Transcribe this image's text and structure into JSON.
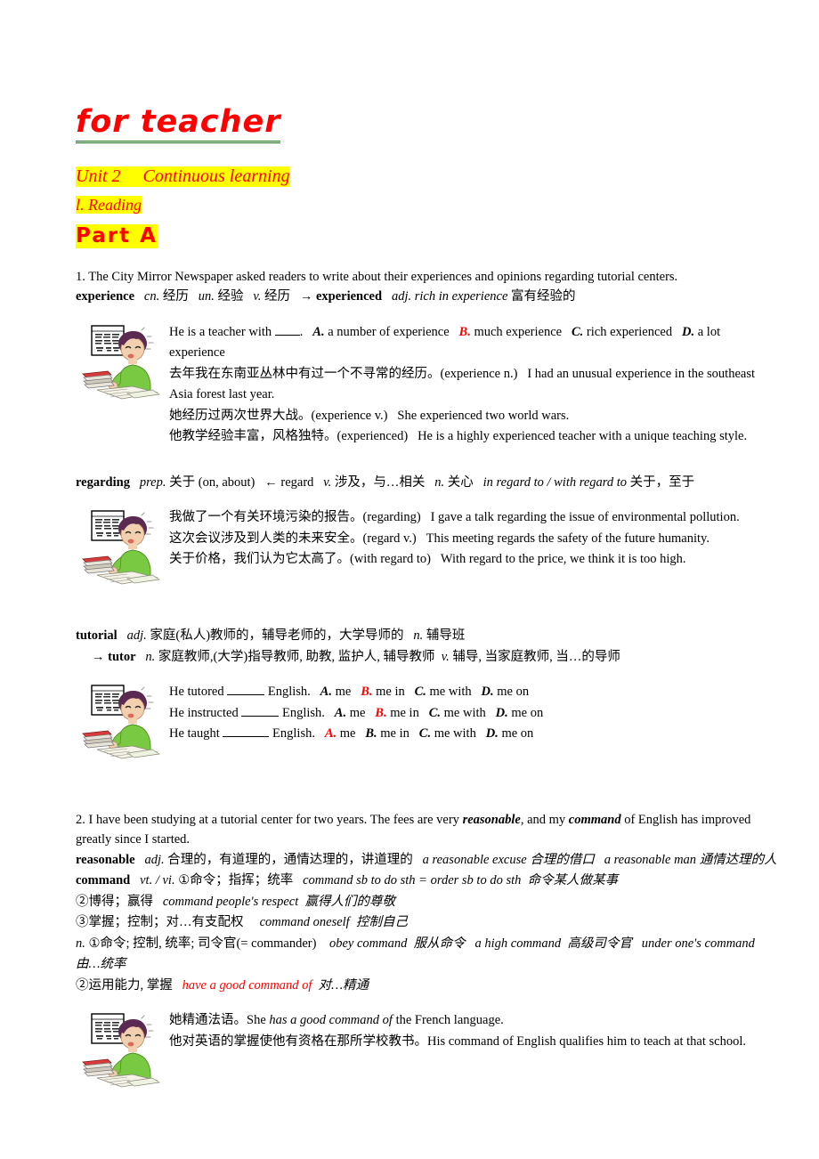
{
  "document": {
    "title": "for teacher",
    "unit_heading": "Unit 2     Continuous learning",
    "section_heading": "l. Reading",
    "part_heading": "Part A",
    "colors": {
      "heading_text": "#ff0000",
      "highlight": "#ffff00",
      "title_underline": "#1a6b1a",
      "body_text": "#000000"
    }
  },
  "item1": {
    "sentence": "1. The City Mirror Newspaper asked readers to write about their experiences and opinions regarding tutorial centers.",
    "experience_entry": {
      "headword": "experience",
      "pos1": "cn.",
      "gloss1": "经历",
      "pos2": "un.",
      "gloss2": "经验",
      "pos3": "v.",
      "gloss3": "经历",
      "arrow_form": "→ experienced",
      "arrow_phrase": "adj. rich in experience",
      "arrow_gloss": "富有经验的"
    },
    "examples": [
      {
        "prompt": "He is a teacher with",
        "tail": ".",
        "options": [
          {
            "letter": "A.",
            "text": "a number of experience",
            "correct": false
          },
          {
            "letter": "B.",
            "text": "much experience",
            "correct": true
          },
          {
            "letter": "C.",
            "text": "rich experienced",
            "correct": false
          },
          {
            "letter": "D.",
            "text": "a lot experience",
            "correct": false
          }
        ]
      },
      {
        "chinese": "去年我在东南亚丛林中有过一个不寻常的经历。",
        "tag": "(experience    n.)",
        "english": "I had an unusual experience in the southeast Asia forest last year."
      },
      {
        "chinese": "她经历过两次世界大战。",
        "tag": "(experience    v.)",
        "english": "She experienced two world wars."
      },
      {
        "chinese": "他教学经验丰富，风格独特。",
        "tag": "(experienced)",
        "english": "He is a highly experienced teacher with a unique teaching style."
      }
    ],
    "regarding_entry": {
      "headword": "regarding",
      "pos1": "prep.",
      "gloss1": "关于",
      "paren": "(on, about)",
      "arrow_form": "← regard",
      "pos2": "v.",
      "gloss2": "涉及，与…相关",
      "pos3": "n.",
      "gloss3": "关心",
      "phrase": "in regard to / with regard to",
      "phrase_gloss": "关于，至于"
    },
    "regarding_examples": [
      {
        "chinese": "我做了一个有关环境污染的报告。",
        "tag": "(regarding)",
        "english": "I gave a talk regarding the issue of environmental pollution."
      },
      {
        "chinese": "这次会议涉及到人类的未来安全。",
        "tag": "(regard    v.)",
        "english": "This meeting regards the safety of the future humanity."
      },
      {
        "chinese": "关于价格，我们认为它太高了。",
        "tag": "(with regard to)",
        "english": "With regard to the price, we think it is too high."
      }
    ],
    "tutorial_entry": {
      "headword": "tutorial",
      "pos1": "adj.",
      "gloss1": "家庭(私人)教师的，辅导老师的，大学导师的",
      "pos2": "n.",
      "gloss2": "辅导班",
      "arrow_form": "→ tutor",
      "arrow_pos1": "n.",
      "arrow_gloss1": "家庭教师,(大学)指导教师, 助教, 监护人, 辅导教师",
      "arrow_pos2": "v.",
      "arrow_gloss2": "辅导, 当家庭教师, 当…的导师"
    },
    "tutorial_examples": [
      {
        "prompt": "He tutored",
        "tail": "English.",
        "options": [
          {
            "letter": "A.",
            "text": "me",
            "correct": false
          },
          {
            "letter": "B.",
            "text": "me in",
            "correct": true
          },
          {
            "letter": "C.",
            "text": "me with",
            "correct": false
          },
          {
            "letter": "D.",
            "text": "me on",
            "correct": false
          }
        ]
      },
      {
        "prompt": "He instructed",
        "tail": "English.",
        "options": [
          {
            "letter": "A.",
            "text": "me",
            "correct": false
          },
          {
            "letter": "B.",
            "text": "me in",
            "correct": true
          },
          {
            "letter": "C.",
            "text": "me with",
            "correct": false
          },
          {
            "letter": "D.",
            "text": "me on",
            "correct": false
          }
        ]
      },
      {
        "prompt": "He taught",
        "tail": "English.",
        "options": [
          {
            "letter": "A.",
            "text": "me",
            "correct": true
          },
          {
            "letter": "B.",
            "text": "me in",
            "correct": false
          },
          {
            "letter": "C.",
            "text": "me with",
            "correct": false
          },
          {
            "letter": "D.",
            "text": "me on",
            "correct": false
          }
        ]
      }
    ]
  },
  "item2": {
    "sentence": "2. I have been studying at a tutorial center for two years. The fees are very reasonable, and my command of English has improved greatly since I started.",
    "sentence_bold_italic_1": "reasonable",
    "sentence_bold_italic_2": "command",
    "reasonable_entry": {
      "headword": "reasonable",
      "pos": "adj.",
      "gloss": "合理的，有道理的，通情达理的，讲道理的",
      "phrase1": "a reasonable excuse",
      "phrase1_gloss": "合理的借口",
      "phrase2": "a reasonable man",
      "phrase2_gloss": "通情达理的人"
    },
    "command_entry": {
      "headword": "command",
      "pos": "vt. / vi.",
      "sense1_num": "①",
      "sense1": "命令；指挥；统率",
      "sense1_phrase": "command sb to do sth = order sb to do sth",
      "sense1_gloss": "命令某人做某事",
      "sense2_num": "②",
      "sense2": "博得；赢得",
      "sense2_phrase": "command people's respect",
      "sense2_gloss": "赢得人们的尊敬",
      "sense3_num": "③",
      "sense3": "掌握；控制；对…有支配权",
      "sense3_phrase": "command oneself",
      "sense3_gloss": "控制自己",
      "noun_pos": "n.",
      "noun_sense1_num": "①",
      "noun_sense1": "命令; 控制, 统率; 司令官(= commander)",
      "noun_phrase1": "obey command",
      "noun_phrase1_gloss": "服从命令",
      "noun_phrase2": "a high command",
      "noun_phrase2_gloss": "高级司令官",
      "noun_phrase3": "under one's command",
      "noun_phrase3_gloss": "由…统率",
      "noun_sense2_num": "②",
      "noun_sense2": "运用能力, 掌握",
      "noun_phrase4": "have a good command of",
      "noun_phrase4_gloss": "对…精通"
    },
    "examples": [
      {
        "chinese": "她精通法语。",
        "english_pre": "She ",
        "english_italic": "has a good command of",
        "english_post": " the French language."
      },
      {
        "chinese": "他对英语的掌握使他有资格在那所学校教书。",
        "english_pre": "His command of English qualifies him to teach at that school.",
        "english_italic": "",
        "english_post": ""
      }
    ]
  },
  "illustration": {
    "name": "student-studying-at-desk",
    "sign_text": "先工的\n课堂学\n好  啊",
    "colors": {
      "shirt": "#7ac943",
      "hair": "#5b2a52",
      "skin": "#f2cfae",
      "book_top": "#d93a3a",
      "desk_paper": "#f5f3e8",
      "sign_border": "#000000"
    }
  }
}
